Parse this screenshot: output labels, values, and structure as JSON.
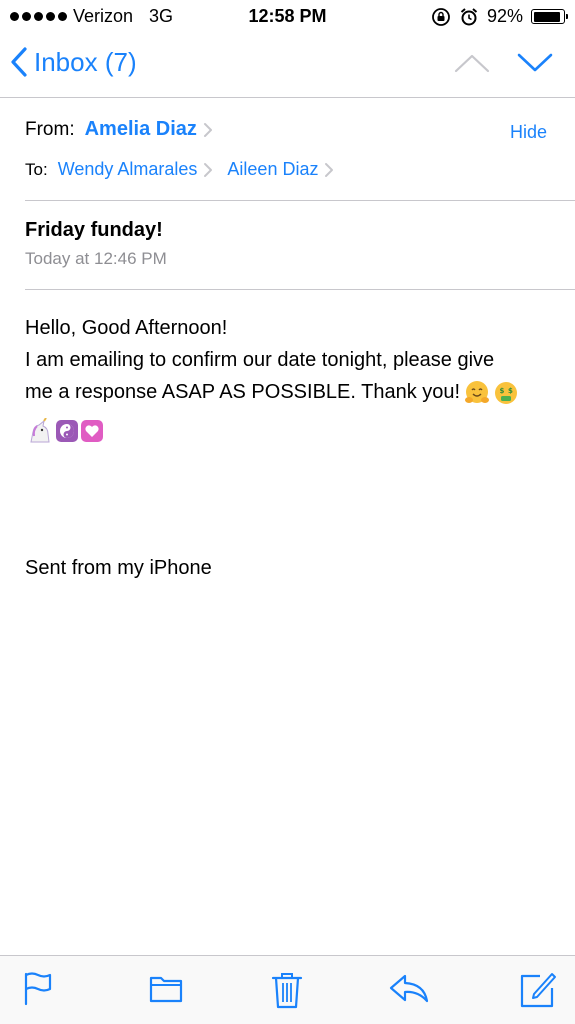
{
  "status_bar": {
    "carrier": "Verizon",
    "network": "3G",
    "time": "12:58 PM",
    "battery": "92%",
    "battery_level": 0.92
  },
  "nav": {
    "back_label": "Inbox (7)"
  },
  "header": {
    "from_label": "From:",
    "from_name": "Amelia Diaz",
    "hide_label": "Hide",
    "to_label": "To:",
    "recipients": [
      "Wendy Almarales",
      "Aileen Diaz"
    ]
  },
  "message": {
    "subject": "Friday funday!",
    "date": "Today at 12:46 PM",
    "body_lines": [
      "Hello, Good Afternoon!",
      "I am emailing to confirm our date tonight, please give",
      "me a response ASAP AS POSSIBLE. Thank you!"
    ],
    "signature": "Sent from my iPhone"
  },
  "icons": {
    "accent_color": "#1a82fb",
    "toolbar": [
      "flag-icon",
      "folder-icon",
      "trash-icon",
      "reply-icon",
      "compose-icon"
    ]
  }
}
